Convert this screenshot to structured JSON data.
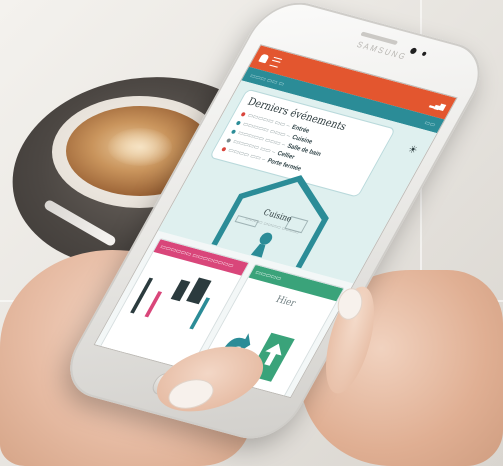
{
  "colors": {
    "appbar": "#e3562f",
    "subbar": "#2b8c97",
    "hero_bg": "#dff0ef",
    "house_stroke": "#2b8c97",
    "card_left_header": "#d9467a",
    "card_right_header": "#3aa37a",
    "event_red": "#d9453c",
    "event_teal": "#2b8c97",
    "event_gray": "#7b8a8d"
  },
  "phone": {
    "brand": "SAMSUNG"
  },
  "screen": {
    "appbar": {
      "menu_icon": "menu-icon",
      "bell_icon": "bell-icon",
      "status_icon": "signal-icon"
    },
    "events": {
      "title": "Derniers événements",
      "items": [
        {
          "color": "#d9453c",
          "place": "Entrée"
        },
        {
          "color": "#2b8c97",
          "place": "Cuisine"
        },
        {
          "color": "#2b8c97",
          "place": "Salle de bain"
        },
        {
          "color": "#7b8a8d",
          "place": "Cellier"
        },
        {
          "color": "#d9453c",
          "place": "Porte fermée"
        }
      ]
    },
    "house": {
      "room": "Cuisine"
    },
    "cards": {
      "right_body": "Hier"
    }
  }
}
